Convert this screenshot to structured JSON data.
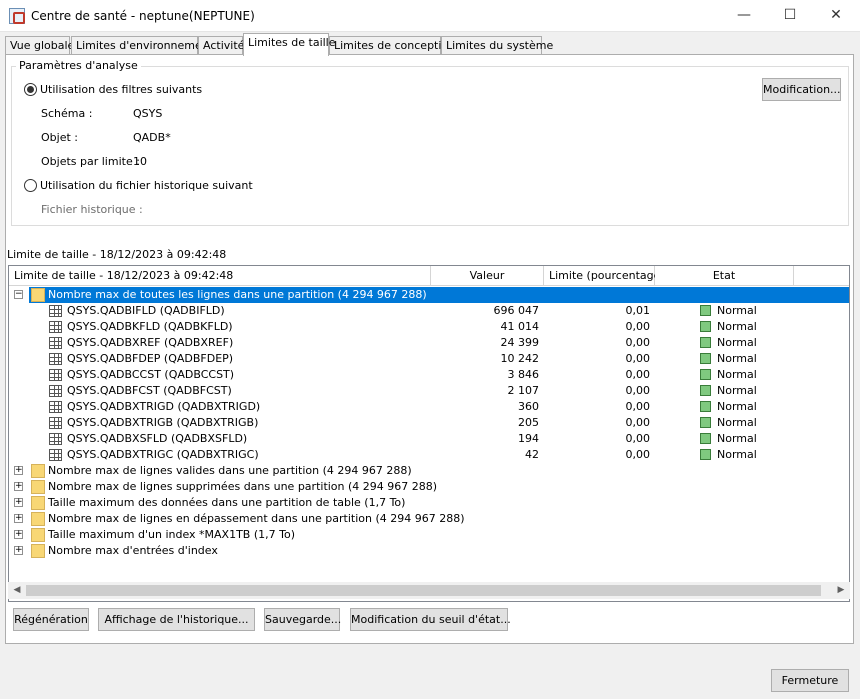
{
  "window": {
    "title": "Centre de santé - neptune(NEPTUNE)",
    "minimize": "—",
    "maximize": "☐",
    "close": "✕"
  },
  "tabs": [
    "Vue globale",
    "Limites d'environnement",
    "Activité",
    "Limites de taille",
    "Limites de conception",
    "Limites du système"
  ],
  "analysis": {
    "legend": "Paramètres d'analyse",
    "use_filters": "Utilisation des filtres suivants",
    "schema_label": "Schéma :",
    "schema_value": "QSYS",
    "object_label": "Objet :",
    "object_value": "QADB*",
    "per_limit_label": "Objets par limite :",
    "per_limit_value": "10",
    "use_history": "Utilisation du fichier historique suivant",
    "history_label": "Fichier historique :",
    "modify_button": "Modification..."
  },
  "section_label": "Limite de taille - 18/12/2023 à 09:42:48",
  "columns": [
    "Limite de taille - 18/12/2023 à 09:42:48",
    "Valeur",
    "Limite (pourcentage)",
    "Etat"
  ],
  "tree": {
    "expanded_group": "Nombre max de toutes les lignes dans une partition  (4 294 967 288)",
    "items": [
      {
        "name": "QSYS.QADBIFLD  (QADBIFLD)",
        "value": "696 047",
        "pct": "0,01",
        "state": "Normal"
      },
      {
        "name": "QSYS.QADBKFLD  (QADBKFLD)",
        "value": "41 014",
        "pct": "0,00",
        "state": "Normal"
      },
      {
        "name": "QSYS.QADBXREF  (QADBXREF)",
        "value": "24 399",
        "pct": "0,00",
        "state": "Normal"
      },
      {
        "name": "QSYS.QADBFDEP  (QADBFDEP)",
        "value": "10 242",
        "pct": "0,00",
        "state": "Normal"
      },
      {
        "name": "QSYS.QADBCCST  (QADBCCST)",
        "value": "3 846",
        "pct": "0,00",
        "state": "Normal"
      },
      {
        "name": "QSYS.QADBFCST  (QADBFCST)",
        "value": "2 107",
        "pct": "0,00",
        "state": "Normal"
      },
      {
        "name": "QSYS.QADBXTRIGD  (QADBXTRIGD)",
        "value": "360",
        "pct": "0,00",
        "state": "Normal"
      },
      {
        "name": "QSYS.QADBXTRIGB  (QADBXTRIGB)",
        "value": "205",
        "pct": "0,00",
        "state": "Normal"
      },
      {
        "name": "QSYS.QADBXSFLD  (QADBXSFLD)",
        "value": "194",
        "pct": "0,00",
        "state": "Normal"
      },
      {
        "name": "QSYS.QADBXTRIGC  (QADBXTRIGC)",
        "value": "42",
        "pct": "0,00",
        "state": "Normal"
      }
    ],
    "collapsed_groups": [
      "Nombre max de lignes valides dans une partition  (4 294 967 288)",
      "Nombre max de lignes supprimées dans une partition  (4 294 967 288)",
      "Taille maximum des données dans une partition de table  (1,7 To)",
      "Nombre max de lignes en dépassement dans une partition  (4 294 967 288)",
      "Taille maximum d'un index *MAX1TB  (1,7 To)",
      "Nombre max d'entrées d'index"
    ]
  },
  "buttons": {
    "refresh": "Régénération",
    "history": "Affichage de l'historique...",
    "save": "Sauvegarde...",
    "threshold": "Modification du seuil d'état...",
    "close": "Fermeture"
  },
  "colors": {
    "selection": "#0078d7",
    "status_normal": "#7fc97f"
  }
}
